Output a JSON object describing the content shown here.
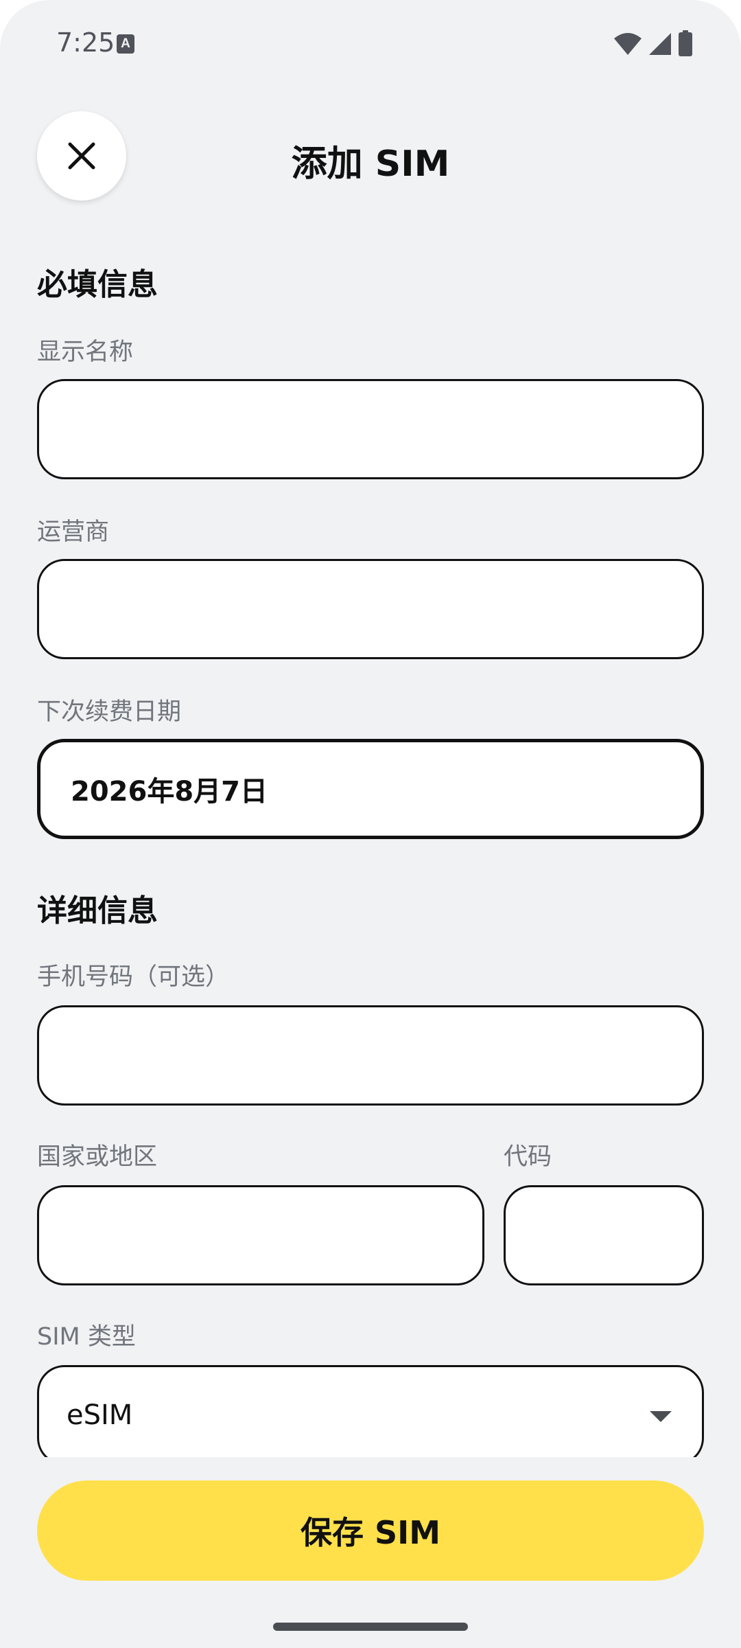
{
  "status_bar": {
    "time": "7:25",
    "icons": [
      "keyboard-a-icon",
      "wifi-icon",
      "cellular-signal-icon",
      "battery-icon"
    ]
  },
  "header": {
    "close_icon": "close-icon",
    "title": "添加 SIM"
  },
  "required_section": {
    "title": "必填信息",
    "display_name": {
      "label": "显示名称",
      "value": "",
      "placeholder": ""
    },
    "carrier": {
      "label": "运营商",
      "value": "",
      "placeholder": ""
    },
    "renewal_date": {
      "label": "下次续费日期",
      "value": "2026年8月7日"
    }
  },
  "details_section": {
    "title": "详细信息",
    "phone_number": {
      "label": "手机号码（可选）",
      "value": ""
    },
    "country": {
      "label": "国家或地区",
      "value": ""
    },
    "code": {
      "label": "代码",
      "value": ""
    },
    "sim_type": {
      "label": "SIM 类型",
      "selected": "eSIM"
    }
  },
  "footer": {
    "save_label": "保存 SIM"
  },
  "colors": {
    "background": "#f1f2f4",
    "accent": "#ffe04a",
    "border": "#111111",
    "label": "#71757c"
  }
}
